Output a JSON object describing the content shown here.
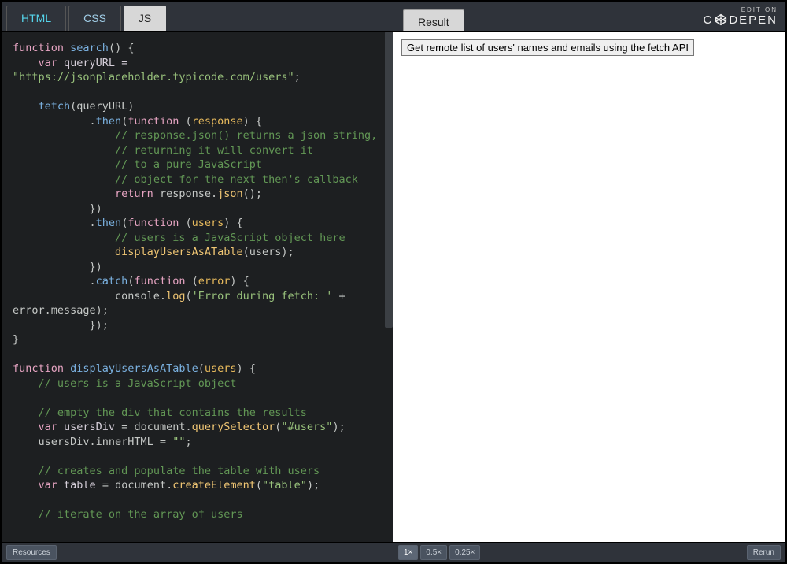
{
  "tabs": {
    "html": "HTML",
    "css": "CSS",
    "js": "JS",
    "result": "Result"
  },
  "brand": {
    "edit_on": "EDIT ON",
    "name_prefix": "C",
    "name_suffix": "DEPEN"
  },
  "code": {
    "l01_kw1": "function",
    "l01_fn": " search",
    "l01_rest": "() {",
    "l02_pad": "    ",
    "l02_kw": "var",
    "l02_id": " queryURL ",
    "l02_op": "=",
    "l03_str": "\"https://jsonplaceholder.typicode.com/users\"",
    "l03_semi": ";",
    "l05_pad": "    ",
    "l05_fn": "fetch",
    "l05_rest": "(queryURL)",
    "l06_pad": "            .",
    "l06_fn": "then",
    "l06_open": "(",
    "l06_kw": "function",
    "l06_rest": " (",
    "l06_par": "response",
    "l06_close": ") {",
    "l07_pad": "                ",
    "l07_cm": "// response.json() returns a json string,",
    "l08_pad": "                ",
    "l08_cm": "// returning it will convert it",
    "l09_pad": "                ",
    "l09_cm": "// to a pure JavaScript",
    "l10_pad": "                ",
    "l10_cm": "// object for the next then's callback",
    "l11_pad": "                ",
    "l11_kw": "return",
    "l11_obj": " response.",
    "l11_fn": "json",
    "l11_rest": "();",
    "l12_pad": "            })",
    "l13_pad": "            .",
    "l13_fn": "then",
    "l13_open": "(",
    "l13_kw": "function",
    "l13_rest": " (",
    "l13_par": "users",
    "l13_close": ") {",
    "l14_pad": "                ",
    "l14_cm": "// users is a JavaScript object here",
    "l15_pad": "                ",
    "l15_fn": "displayUsersAsATable",
    "l15_rest": "(users);",
    "l16_pad": "            })",
    "l17_pad": "            .",
    "l17_fn": "catch",
    "l17_open": "(",
    "l17_kw": "function",
    "l17_rest": " (",
    "l17_par": "error",
    "l17_close": ") {",
    "l18_pad": "                console.",
    "l18_fn": "log",
    "l18_open": "(",
    "l18_str": "'Error during fetch: '",
    "l18_rest": " +",
    "l19_txt": "error.message);",
    "l20_pad": "            });",
    "l21_txt": "}",
    "l23_kw": "function",
    "l23_fn": " displayUsersAsATable",
    "l23_rest": "(",
    "l23_par": "users",
    "l23_close": ") {",
    "l24_pad": "    ",
    "l24_cm": "// users is a JavaScript object",
    "l26_pad": "    ",
    "l26_cm": "// empty the div that contains the results",
    "l27_pad": "    ",
    "l27_kw": "var",
    "l27_id": " usersDiv ",
    "l27_op": "= document.",
    "l27_fn": "querySelector",
    "l27_open": "(",
    "l27_str": "\"#users\"",
    "l27_close": ");",
    "l28_pad": "    usersDiv.innerHTML = ",
    "l28_str": "\"\"",
    "l28_semi": ";",
    "l30_pad": "    ",
    "l30_cm": "// creates and populate the table with users",
    "l31_pad": "    ",
    "l31_kw": "var",
    "l31_id": " table ",
    "l31_op": "= document.",
    "l31_fn": "createElement",
    "l31_open": "(",
    "l31_str": "\"table\"",
    "l31_close": ");",
    "l33_pad": "    ",
    "l33_cm": "// iterate on the array of users"
  },
  "preview": {
    "button_label": "Get remote list of users' names and emails using the fetch API"
  },
  "bottom": {
    "resources": "Resources",
    "zoom1": "1×",
    "zoom05": "0.5×",
    "zoom025": "0.25×",
    "rerun": "Rerun"
  }
}
